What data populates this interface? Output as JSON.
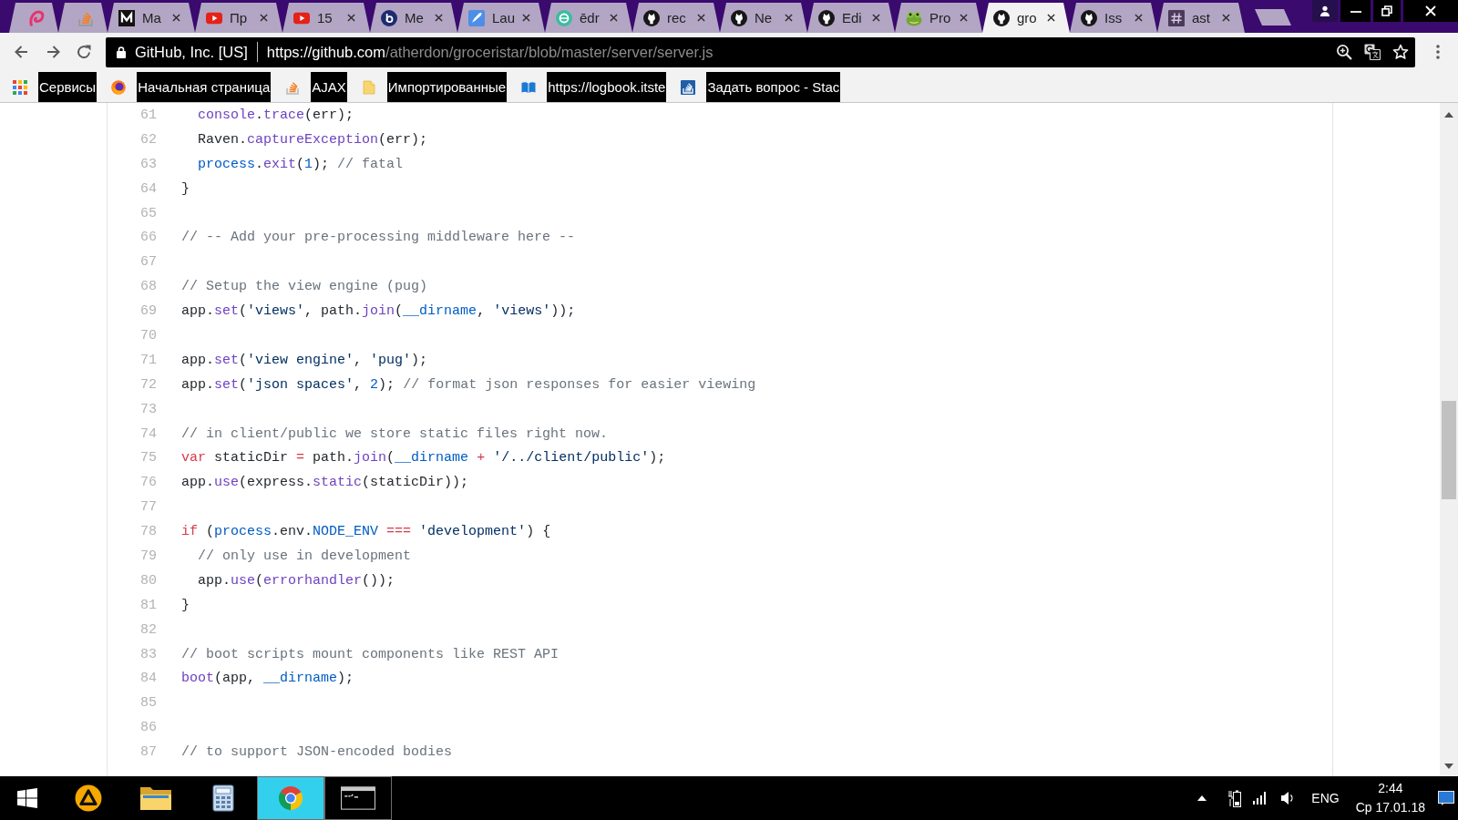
{
  "tabs": [
    {
      "pinned": true,
      "selected": false
    },
    {
      "pinned": true,
      "selected": false
    },
    {
      "title": "Ma",
      "pinned": false,
      "selected": false
    },
    {
      "title": "Пр",
      "pinned": false,
      "selected": false
    },
    {
      "title": "15",
      "pinned": false,
      "selected": false
    },
    {
      "title": "Me",
      "pinned": false,
      "selected": false
    },
    {
      "title": "Lau",
      "pinned": false,
      "selected": false
    },
    {
      "title": "ēdr",
      "pinned": false,
      "selected": false
    },
    {
      "title": "rec",
      "pinned": false,
      "selected": false
    },
    {
      "title": "Ne",
      "pinned": false,
      "selected": false
    },
    {
      "title": "Edi",
      "pinned": false,
      "selected": false
    },
    {
      "title": "Pro",
      "pinned": false,
      "selected": false
    },
    {
      "title": "gro",
      "pinned": false,
      "selected": true
    },
    {
      "title": "Iss",
      "pinned": false,
      "selected": false
    },
    {
      "title": "ast",
      "pinned": false,
      "selected": false
    }
  ],
  "toolbar": {
    "site_identity": "GitHub, Inc. [US]",
    "url_host": "https://github.com",
    "url_path": "/atherdon/groceristar/blob/master/server/server.js"
  },
  "bookmarks": [
    {
      "label": "Сервисы"
    },
    {
      "label": "Начальная страница"
    },
    {
      "label": "AJAX"
    },
    {
      "label": "Импортированные"
    },
    {
      "label": "https://logbook.itste"
    },
    {
      "label": "Задать вопрос - Stac"
    }
  ],
  "code": {
    "lines": [
      {
        "number": "61",
        "tokens": [
          {
            "text": "  console",
            "kind": "entity"
          },
          {
            "text": ".",
            "kind": "plain"
          },
          {
            "text": "trace",
            "kind": "entity"
          },
          {
            "text": "(err);",
            "kind": "plain"
          }
        ]
      },
      {
        "number": "62",
        "tokens": [
          {
            "text": "  Raven.",
            "kind": "plain"
          },
          {
            "text": "captureException",
            "kind": "entity"
          },
          {
            "text": "(err);",
            "kind": "plain"
          }
        ]
      },
      {
        "number": "63",
        "tokens": [
          {
            "text": "  process",
            "kind": "constant"
          },
          {
            "text": ".",
            "kind": "plain"
          },
          {
            "text": "exit",
            "kind": "entity"
          },
          {
            "text": "(",
            "kind": "plain"
          },
          {
            "text": "1",
            "kind": "constant"
          },
          {
            "text": "); ",
            "kind": "plain"
          },
          {
            "text": "// fatal",
            "kind": "comment"
          }
        ]
      },
      {
        "number": "64",
        "tokens": [
          {
            "text": "}",
            "kind": "plain"
          }
        ]
      },
      {
        "number": "65"
      },
      {
        "number": "66",
        "tokens": [
          {
            "text": "// -- Add your pre-processing middleware here --",
            "kind": "comment"
          }
        ]
      },
      {
        "number": "67"
      },
      {
        "number": "68",
        "tokens": [
          {
            "text": "// Setup the view engine (pug)",
            "kind": "comment"
          }
        ]
      },
      {
        "number": "69",
        "tokens": [
          {
            "text": "app.",
            "kind": "plain"
          },
          {
            "text": "set",
            "kind": "entity"
          },
          {
            "text": "(",
            "kind": "plain"
          },
          {
            "text": "'views'",
            "kind": "string"
          },
          {
            "text": ", path.",
            "kind": "plain"
          },
          {
            "text": "join",
            "kind": "entity"
          },
          {
            "text": "(",
            "kind": "plain"
          },
          {
            "text": "__dirname",
            "kind": "constant"
          },
          {
            "text": ", ",
            "kind": "plain"
          },
          {
            "text": "'views'",
            "kind": "string"
          },
          {
            "text": "));",
            "kind": "plain"
          }
        ]
      },
      {
        "number": "70"
      },
      {
        "number": "71",
        "tokens": [
          {
            "text": "app.",
            "kind": "plain"
          },
          {
            "text": "set",
            "kind": "entity"
          },
          {
            "text": "(",
            "kind": "plain"
          },
          {
            "text": "'view engine'",
            "kind": "string"
          },
          {
            "text": ", ",
            "kind": "plain"
          },
          {
            "text": "'pug'",
            "kind": "string"
          },
          {
            "text": ");",
            "kind": "plain"
          }
        ]
      },
      {
        "number": "72",
        "tokens": [
          {
            "text": "app.",
            "kind": "plain"
          },
          {
            "text": "set",
            "kind": "entity"
          },
          {
            "text": "(",
            "kind": "plain"
          },
          {
            "text": "'json spaces'",
            "kind": "string"
          },
          {
            "text": ", ",
            "kind": "plain"
          },
          {
            "text": "2",
            "kind": "constant"
          },
          {
            "text": "); ",
            "kind": "plain"
          },
          {
            "text": "// format json responses for easier viewing",
            "kind": "comment"
          }
        ]
      },
      {
        "number": "73"
      },
      {
        "number": "74",
        "tokens": [
          {
            "text": "// in client/public we store static files right now.",
            "kind": "comment"
          }
        ]
      },
      {
        "number": "75",
        "tokens": [
          {
            "text": "var",
            "kind": "keyword"
          },
          {
            "text": " staticDir ",
            "kind": "plain"
          },
          {
            "text": "=",
            "kind": "keyword"
          },
          {
            "text": " path.",
            "kind": "plain"
          },
          {
            "text": "join",
            "kind": "entity"
          },
          {
            "text": "(",
            "kind": "plain"
          },
          {
            "text": "__dirname",
            "kind": "constant"
          },
          {
            "text": " + ",
            "kind": "keyword"
          },
          {
            "text": "'/../client/public'",
            "kind": "string"
          },
          {
            "text": ");",
            "kind": "plain"
          }
        ]
      },
      {
        "number": "76",
        "tokens": [
          {
            "text": "app.",
            "kind": "plain"
          },
          {
            "text": "use",
            "kind": "entity"
          },
          {
            "text": "(express.",
            "kind": "plain"
          },
          {
            "text": "static",
            "kind": "entity"
          },
          {
            "text": "(staticDir));",
            "kind": "plain"
          }
        ]
      },
      {
        "number": "77"
      },
      {
        "number": "78",
        "tokens": [
          {
            "text": "if",
            "kind": "keyword"
          },
          {
            "text": " (",
            "kind": "plain"
          },
          {
            "text": "process",
            "kind": "constant"
          },
          {
            "text": ".env.",
            "kind": "plain"
          },
          {
            "text": "NODE_ENV",
            "kind": "constant"
          },
          {
            "text": " === ",
            "kind": "keyword"
          },
          {
            "text": "'development'",
            "kind": "string"
          },
          {
            "text": ") {",
            "kind": "plain"
          }
        ]
      },
      {
        "number": "79",
        "tokens": [
          {
            "text": "  // only use in development",
            "kind": "comment"
          }
        ]
      },
      {
        "number": "80",
        "tokens": [
          {
            "text": "  app.",
            "kind": "plain"
          },
          {
            "text": "use",
            "kind": "entity"
          },
          {
            "text": "(",
            "kind": "plain"
          },
          {
            "text": "errorhandler",
            "kind": "entity"
          },
          {
            "text": "());",
            "kind": "plain"
          }
        ]
      },
      {
        "number": "81",
        "tokens": [
          {
            "text": "}",
            "kind": "plain"
          }
        ]
      },
      {
        "number": "82"
      },
      {
        "number": "83",
        "tokens": [
          {
            "text": "// boot scripts mount components like REST API",
            "kind": "comment"
          }
        ]
      },
      {
        "number": "84",
        "tokens": [
          {
            "text": "boot",
            "kind": "entity"
          },
          {
            "text": "(app, ",
            "kind": "plain"
          },
          {
            "text": "__dirname",
            "kind": "constant"
          },
          {
            "text": ");",
            "kind": "plain"
          }
        ]
      },
      {
        "number": "85"
      },
      {
        "number": "86"
      },
      {
        "number": "87",
        "tokens": [
          {
            "text": "// to support JSON-encoded bodies",
            "kind": "comment"
          }
        ]
      }
    ]
  },
  "taskbar": {
    "apps": [
      {
        "running": false,
        "selected": false
      },
      {
        "running": false,
        "selected": false
      },
      {
        "running": false,
        "selected": false
      },
      {
        "running": true,
        "selected": true
      },
      {
        "running": true,
        "selected": false
      }
    ],
    "language": "ENG",
    "time": "2:44",
    "date": "Ср 17.01.18"
  }
}
